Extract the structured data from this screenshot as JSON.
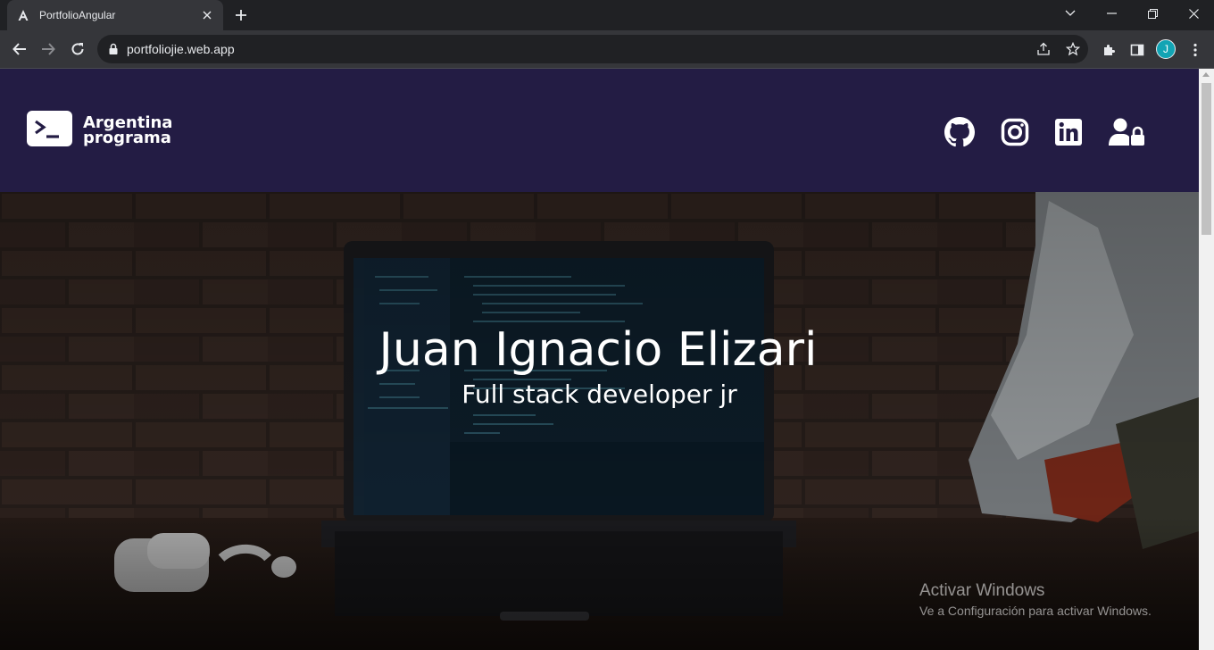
{
  "browser": {
    "tab": {
      "title": "PortfolioAngular",
      "favicon": "angular-icon"
    },
    "url": "portfoliojie.web.app",
    "profile_initial": "J"
  },
  "header": {
    "brand": {
      "line1": "Argentina",
      "line2": "programa",
      "logo": "terminal-prompt-icon"
    },
    "social_icons": [
      "github-icon",
      "instagram-icon",
      "linkedin-icon",
      "user-lock-icon"
    ],
    "background_color": "#231c44"
  },
  "hero": {
    "title": "Juan Ignacio Elizari",
    "subtitle": "Full stack developer jr"
  },
  "watermark": {
    "title": "Activar Windows",
    "subtitle": "Ve a Configuración para activar Windows."
  }
}
